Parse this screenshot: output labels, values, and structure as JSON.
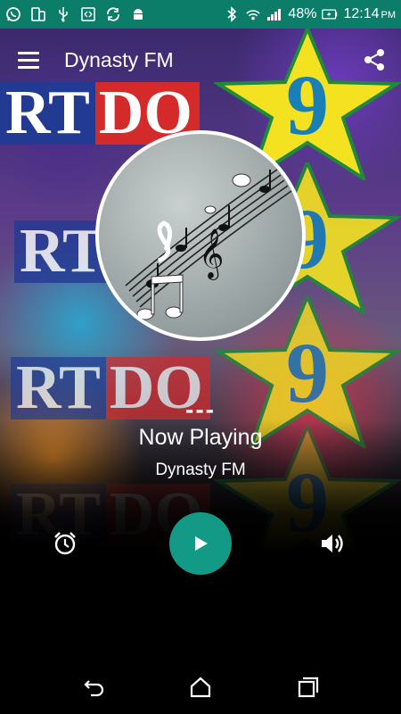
{
  "status_bar": {
    "battery_percent": "48%",
    "time": "12:14",
    "ampm": "PM",
    "left_icons": [
      "whatsapp-icon",
      "tablet-icon",
      "usb-icon",
      "screen-share-icon",
      "sync-icon",
      "android-icon"
    ],
    "right_icons": [
      "bluetooth-icon",
      "wifi-hotspot-icon",
      "signal-icon",
      "battery-charging-icon"
    ],
    "color": "#0b7d68"
  },
  "app_bar": {
    "title": "Dynasty FM",
    "menu_icon": "hamburger-menu-icon",
    "share_icon": "share-icon"
  },
  "background": {
    "logo_text_blue": "RT",
    "logo_text_red": "DO",
    "star_number": "9"
  },
  "player": {
    "dash": "---",
    "status": "Now Playing",
    "station": "Dynasty FM",
    "play_color": "#129a87",
    "controls": [
      "alarm-icon",
      "play-icon",
      "volume-icon"
    ]
  },
  "nav_bar": {
    "buttons": [
      "back-icon",
      "home-icon",
      "recents-icon"
    ]
  }
}
